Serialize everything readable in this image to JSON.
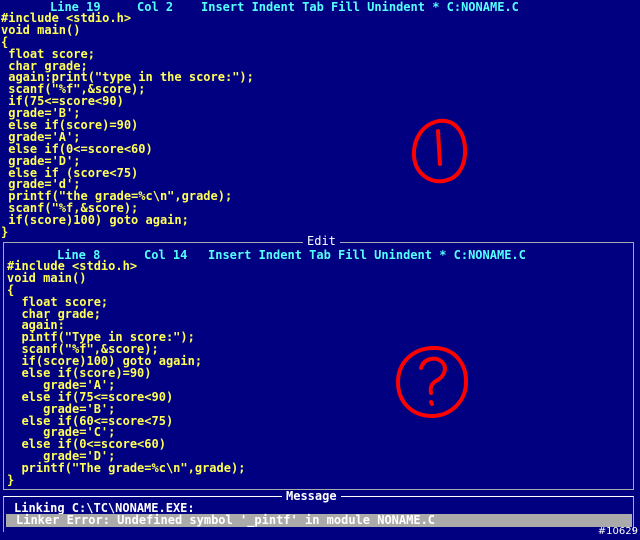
{
  "top_status": {
    "line": "Line 19",
    "col": "Col 2",
    "modes": "Insert Indent Tab Fill Unindent * C:NONAME.C"
  },
  "top_code": [
    "#include <stdio.h>",
    "void main()",
    "{",
    " float score;",
    " char grade;",
    " again:print(\"type in the score:\");",
    " scanf(\"%f\",&score);",
    " if(75<=score<90)",
    " grade='B';",
    " else if(score)=90)",
    " grade='A';",
    " else if(0<=score<60)",
    " grade='D';",
    " else if (score<75)",
    " grade='d';",
    " printf(\"the grade=%c\\n\",grade);",
    " scanf(\"%f,&score);",
    " if(score)100) goto again;",
    "}"
  ],
  "edit_window": {
    "title": "Edit",
    "status": {
      "line": "Line 8",
      "col": "Col 14",
      "modes": "Insert Indent Tab Fill Unindent * C:NONAME.C"
    },
    "code": [
      "#include <stdio.h>",
      "void main()",
      "{",
      "  float score;",
      "  char grade;",
      "  again:",
      "  pintf(\"Type in score:\");",
      "  scanf(\"%f\",&score);",
      "  if(score)100) goto again;",
      "  else if(score)=90)",
      "     grade='A';",
      "  else if(75<=score<90)",
      "     grade='B';",
      "  else if(60<=score<75)",
      "     grade='C';",
      "  else if(0<=score<60)",
      "     grade='D';",
      "  printf(\"The grade=%c\\n\",grade);",
      "}"
    ]
  },
  "message_window": {
    "title": "Message",
    "line1": "Linking C:\\TC\\NONAME.EXE:",
    "line2": "Linker Error: Undefined symbol '_pintf' in module NONAME.C"
  },
  "watermark": "#10629",
  "annotations": {
    "color": "#ff0000"
  },
  "colors": {
    "background": "#000080",
    "code_text": "#ffff55",
    "status_text": "#55ffff",
    "message_highlight": "#aaaaaa"
  }
}
